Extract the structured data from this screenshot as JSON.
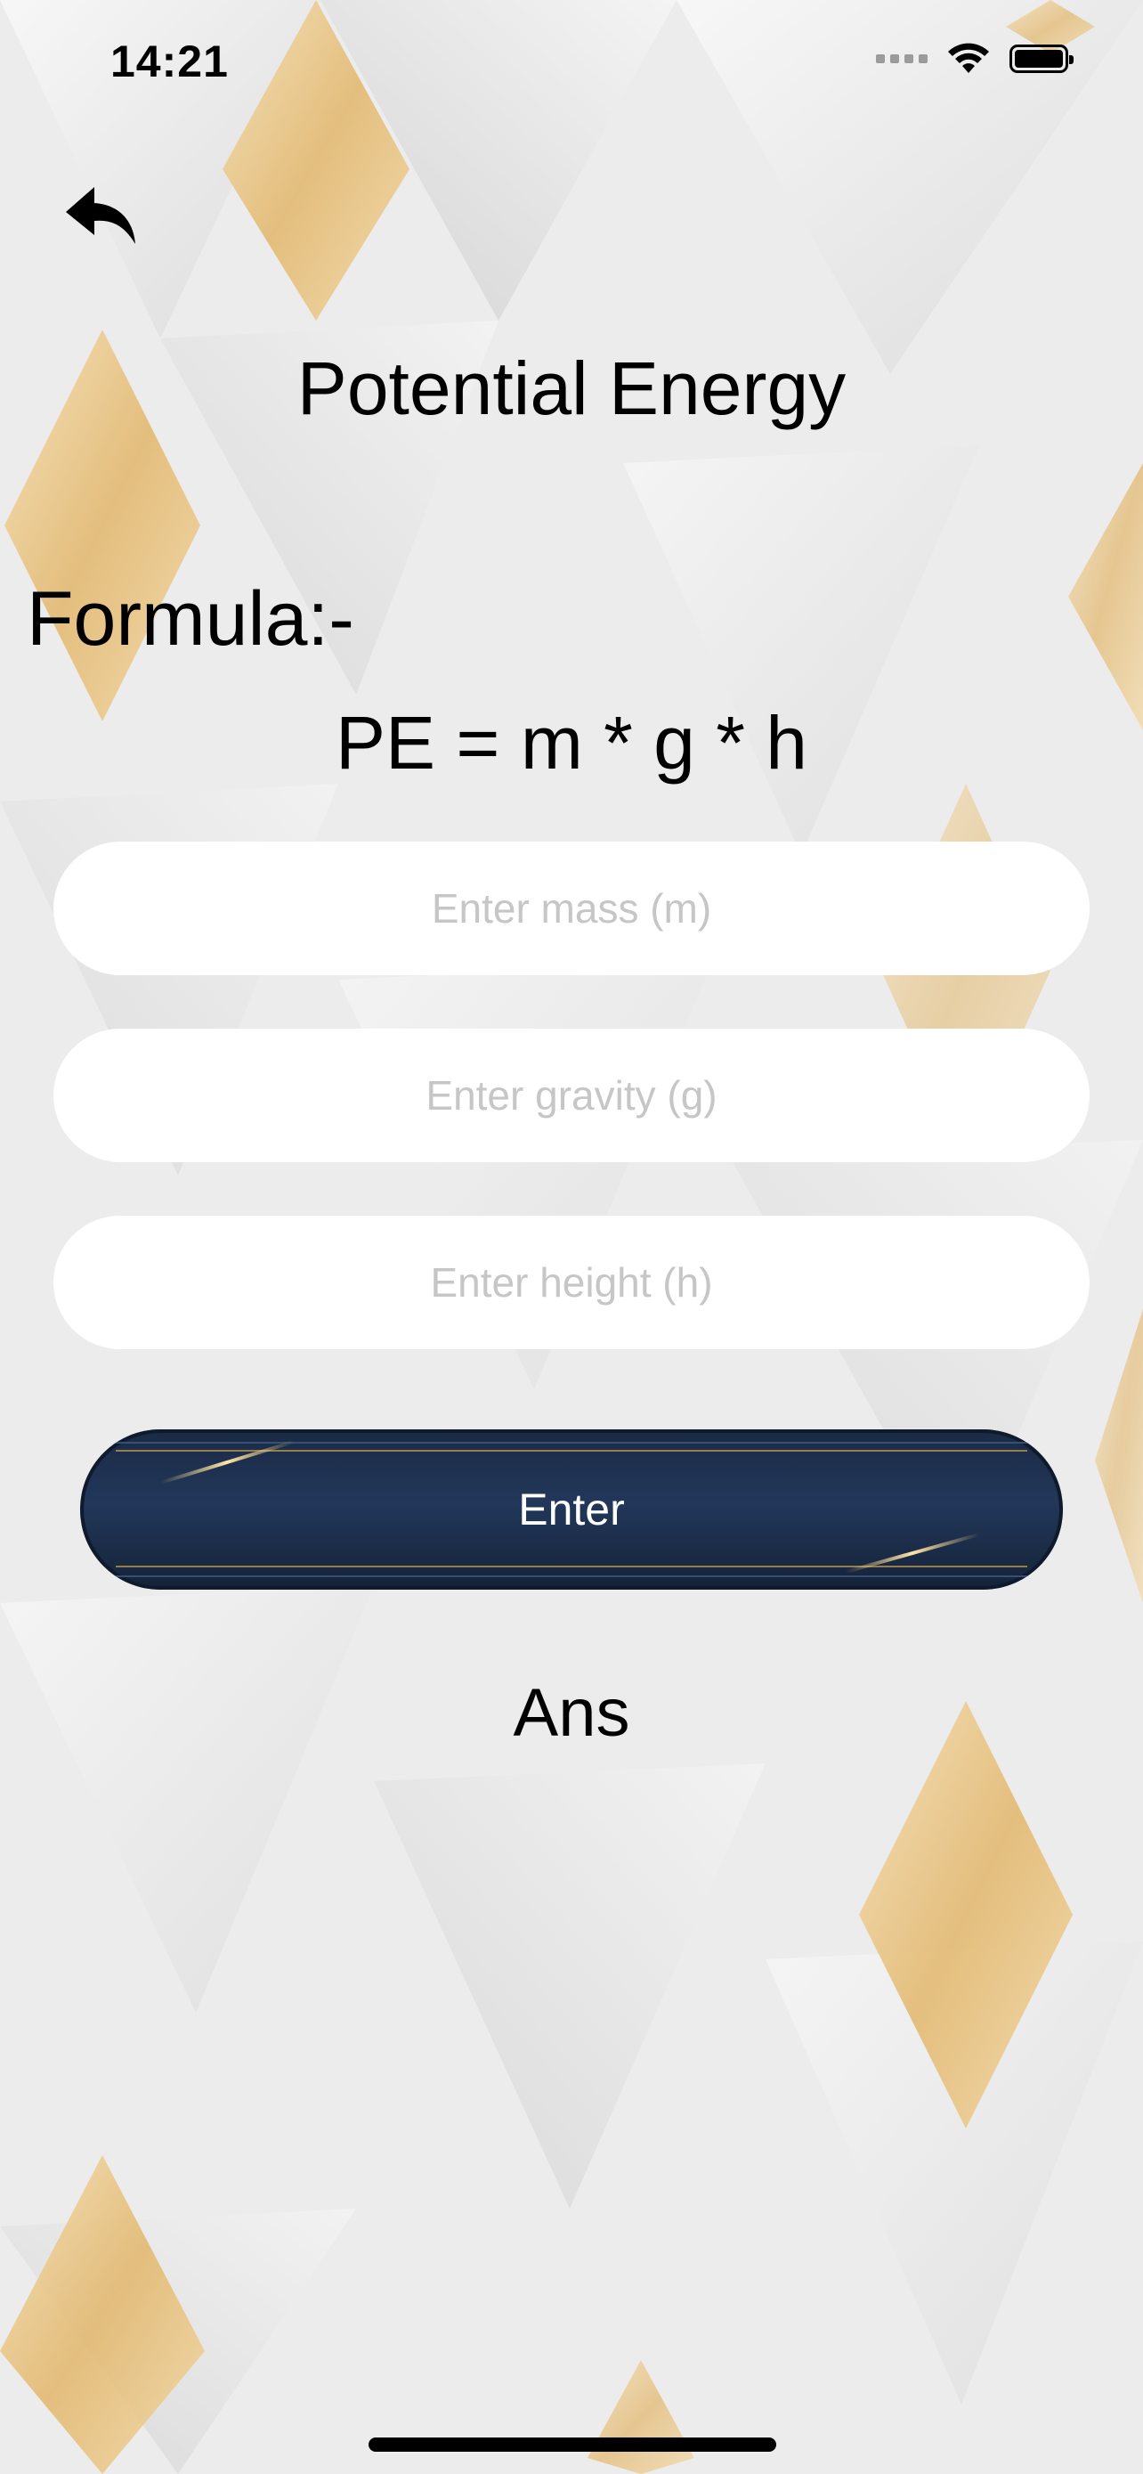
{
  "status_bar": {
    "time": "14:21",
    "wifi_icon": "wifi-icon",
    "battery_icon": "battery-icon"
  },
  "nav": {
    "back_icon": "reply-arrow-icon"
  },
  "title": "Potential Energy",
  "formula": {
    "label": "Formula:-",
    "expression": "PE = m * g * h"
  },
  "inputs": {
    "mass": {
      "placeholder": "Enter mass (m)",
      "value": ""
    },
    "gravity": {
      "placeholder": "Enter gravity (g)",
      "value": ""
    },
    "height": {
      "placeholder": "Enter height (h)",
      "value": ""
    }
  },
  "enter_button": {
    "label": "Enter"
  },
  "answer": {
    "label": "Ans"
  },
  "colors": {
    "background": "#ebebeb",
    "accent_gold": "#e2b66a",
    "button_navy": "#1a2a44",
    "field_bg": "#ffffff",
    "placeholder": "#c6c6c6"
  }
}
